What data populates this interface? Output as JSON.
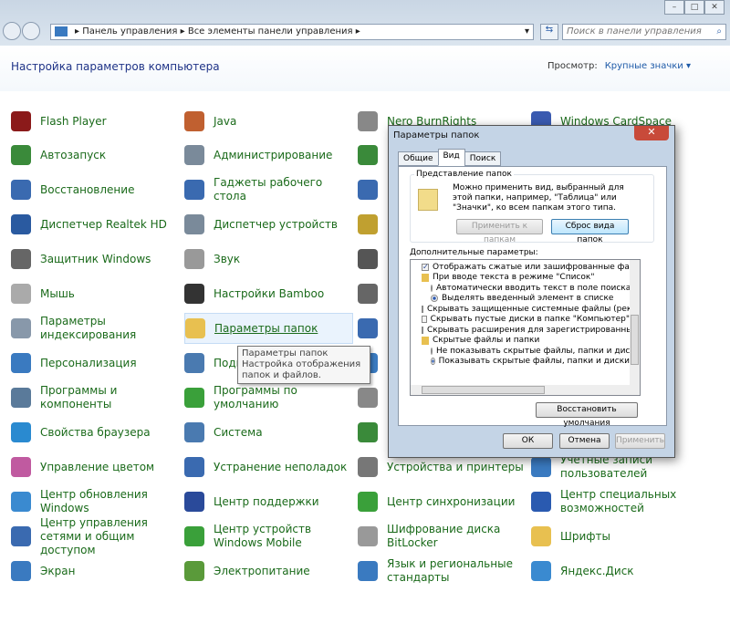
{
  "nav": {
    "breadcrumb": [
      "Панель управления",
      "Все элементы панели управления"
    ],
    "search_placeholder": "Поиск в панели управления"
  },
  "header": {
    "title": "Настройка параметров компьютера",
    "view_label": "Просмотр:",
    "view_value": "Крупные значки"
  },
  "columns": [
    [
      {
        "l": "Flash Player",
        "c": "#8b1a1a"
      },
      {
        "l": "Автозапуск",
        "c": "#3a8a3a"
      },
      {
        "l": "Восстановление",
        "c": "#3a6ab0"
      },
      {
        "l": "Диспетчер Realtek HD",
        "c": "#2a5aa0"
      },
      {
        "l": "Защитник Windows",
        "c": "#666"
      },
      {
        "l": "Мышь",
        "c": "#aaa"
      },
      {
        "l": "Параметры индексирования",
        "c": "#8898aa"
      },
      {
        "l": "Персонализация",
        "c": "#3a7ac0"
      },
      {
        "l": "Программы и компоненты",
        "c": "#5a7a9a"
      },
      {
        "l": "Свойства браузера",
        "c": "#2a8ad0"
      },
      {
        "l": "Управление цветом",
        "c": "#c05aa0"
      },
      {
        "l": "Центр обновления Windows",
        "c": "#3a8ad0"
      },
      {
        "l": "Центр управления сетями и общим доступом",
        "c": "#3a6ab0"
      },
      {
        "l": "Экран",
        "c": "#3a7ac0"
      }
    ],
    [
      {
        "l": "Java",
        "c": "#c06030"
      },
      {
        "l": "Администрирование",
        "c": "#7a8a9a"
      },
      {
        "l": "Гаджеты рабочего стола",
        "c": "#3a6ab0"
      },
      {
        "l": "Диспетчер устройств",
        "c": "#7a8a9a"
      },
      {
        "l": "Звук",
        "c": "#999"
      },
      {
        "l": "Настройки Bamboo",
        "c": "#333"
      },
      {
        "l": "Параметры папок",
        "c": "#e8c050"
      },
      {
        "l": "Подключения к удал...",
        "c": "#4a7ab0"
      },
      {
        "l": "Программы по умолчанию",
        "c": "#3aa03a"
      },
      {
        "l": "Система",
        "c": "#4a7ab0"
      },
      {
        "l": "Устранение неполадок",
        "c": "#3a6ab0"
      },
      {
        "l": "Центр поддержки",
        "c": "#2a4a9a"
      },
      {
        "l": "Центр устройств Windows Mobile",
        "c": "#3aa03a"
      },
      {
        "l": "Электропитание",
        "c": "#5a9a3a"
      }
    ],
    [
      {
        "l": "Nero BurnRights",
        "c": "#888"
      },
      {
        "l": "",
        "c": "#3a8a3a"
      },
      {
        "l": "",
        "c": "#3a6ab0"
      },
      {
        "l": "",
        "c": "#c0a030"
      },
      {
        "l": "",
        "c": "#555"
      },
      {
        "l": "",
        "c": "#666"
      },
      {
        "l": "",
        "c": "#3a6ab0"
      },
      {
        "l": "",
        "c": "#3a7ac0"
      },
      {
        "l": "",
        "c": "#888"
      },
      {
        "l": "",
        "c": "#3a8a3a"
      },
      {
        "l": "Устройства и принтеры",
        "c": "#777"
      },
      {
        "l": "Центр синхронизации",
        "c": "#3aa03a"
      },
      {
        "l": "Шифрование диска BitLocker",
        "c": "#999"
      },
      {
        "l": "Язык и региональные стандарты",
        "c": "#3a7ac0"
      }
    ],
    [
      {
        "l": "Windows CardSpace",
        "c": "#3a5ab0"
      },
      {
        "l": "",
        "c": "#fff"
      },
      {
        "l": "",
        "c": "#fff"
      },
      {
        "l": "",
        "c": "#fff"
      },
      {
        "l": "",
        "c": "#fff"
      },
      {
        "l": "",
        "c": "#fff"
      },
      {
        "l": "",
        "c": "#fff"
      },
      {
        "l": "",
        "c": "#fff"
      },
      {
        "l": "",
        "c": "#fff"
      },
      {
        "l": "",
        "c": "#fff"
      },
      {
        "l": "Учетные записи пользователей",
        "c": "#3a7ac0"
      },
      {
        "l": "Центр специальных возможностей",
        "c": "#2a5ab0"
      },
      {
        "l": "Шрифты",
        "c": "#e8c050"
      },
      {
        "l": "Яндекс.Диск",
        "c": "#3a8ad0"
      }
    ]
  ],
  "tooltip": {
    "title": "Параметры папок",
    "text": "Настройка отображения папок и файлов."
  },
  "dialog": {
    "title": "Параметры папок",
    "tabs": [
      "Общие",
      "Вид",
      "Поиск"
    ],
    "group_title": "Представление папок",
    "group_text": "Можно применить вид, выбранный для этой папки, например, \"Таблица\" или \"Значки\", ко всем папкам этого типа.",
    "apply_folders": "Применить к папкам",
    "reset_folders": "Сброс вида папок",
    "advanced_label": "Дополнительные параметры:",
    "options": [
      {
        "t": "cb",
        "on": true,
        "l": "Отображать сжатые или зашифрованные файлы NTI"
      },
      {
        "t": "fld",
        "l": "При вводе текста в режиме \"Список\""
      },
      {
        "t": "rd",
        "on": false,
        "l": "Автоматически вводить текст в поле поиска"
      },
      {
        "t": "rd",
        "on": true,
        "l": "Выделять введенный элемент в списке"
      },
      {
        "t": "cb",
        "on": false,
        "l": "Скрывать защищенные системные файлы (рекомен"
      },
      {
        "t": "cb",
        "on": false,
        "l": "Скрывать пустые диски в папке \"Компьютер\""
      },
      {
        "t": "cb",
        "on": false,
        "l": "Скрывать расширения для зарегистрированных типо"
      },
      {
        "t": "fld",
        "l": "Скрытые файлы и папки"
      },
      {
        "t": "rd",
        "on": false,
        "l": "Не показывать скрытые файлы, папки и диски"
      },
      {
        "t": "rd",
        "on": true,
        "l": "Показывать скрытые файлы, папки и диски"
      }
    ],
    "restore": "Восстановить умолчания",
    "ok": "ОК",
    "cancel": "Отмена",
    "apply": "Применить"
  }
}
